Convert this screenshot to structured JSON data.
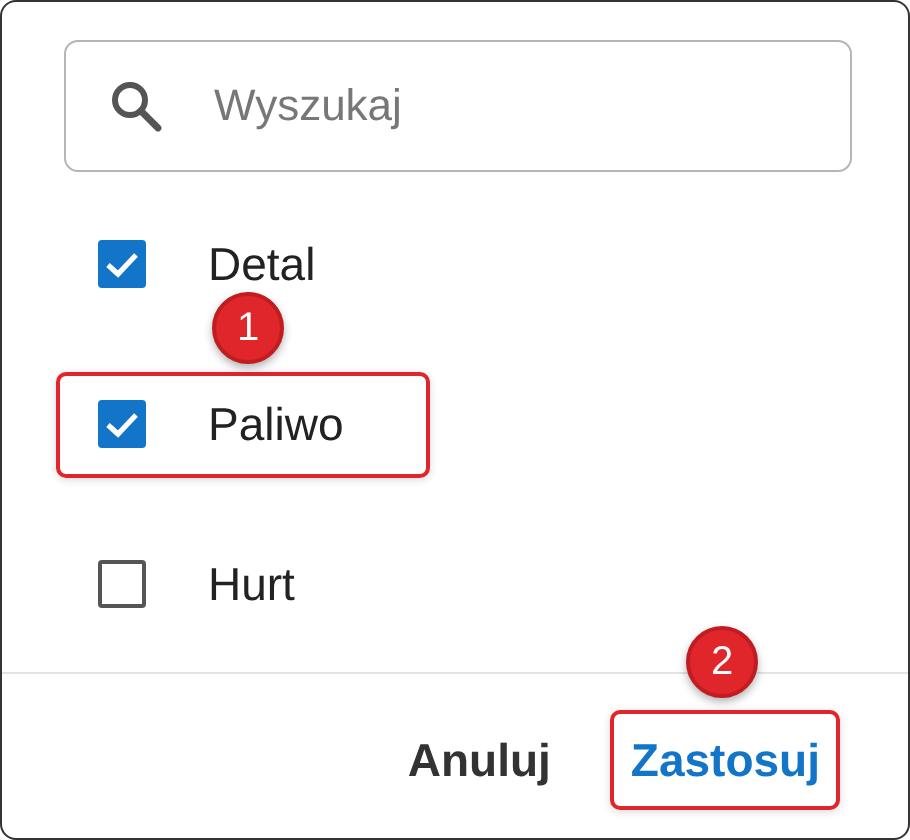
{
  "search": {
    "placeholder": "Wyszukaj"
  },
  "options": [
    {
      "label": "Detal",
      "checked": true,
      "highlighted": false
    },
    {
      "label": "Paliwo",
      "checked": true,
      "highlighted": true
    },
    {
      "label": "Hurt",
      "checked": false,
      "highlighted": false
    }
  ],
  "buttons": [
    {
      "label": "Anuluj",
      "kind": "secondary",
      "highlighted": false
    },
    {
      "label": "Zastosuj",
      "kind": "primary",
      "highlighted": true
    }
  ],
  "annotations": [
    {
      "label": "1"
    },
    {
      "label": "2"
    }
  ]
}
